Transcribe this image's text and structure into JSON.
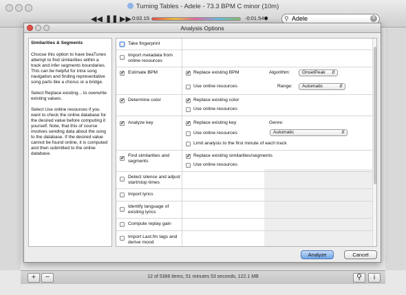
{
  "app": {
    "title": "Turning Tables - Adele - 73.3 BPM C minor (10m)",
    "elapsed": "0:02.15",
    "remaining": "-0:01.54",
    "search_value": "Adele",
    "status": "12 of 5386 items, 51 minutes 53 seconds, 122.1 MB"
  },
  "dialog": {
    "title": "Analysis Options",
    "help_heading": "Similarities & Segments",
    "help_paragraphs": [
      "Choose this option to have beaTunes attempt to find similarities within a track and infer segments boundaries. This can be helpful for intra song navigation and finding representative song parts like a chorus or a bridge.",
      "Select Replace existing... to overwrite existing values.",
      "Select Use online resources if you want to check the online database for the desired value before computing it yourself. Note, that this of course involves sending data about the song to the database. If the desired value cannot be found online, it is computed and then submitted to the online database."
    ],
    "options": [
      {
        "label": "Take fingerprint",
        "checked": false
      },
      {
        "label": "Import metadata from online resources",
        "checked": false
      },
      {
        "label": "Estimate BPM",
        "checked": true
      },
      {
        "label": "Determine color",
        "checked": true
      },
      {
        "label": "Analyze key",
        "checked": true
      },
      {
        "label": "Find similarities and segments",
        "checked": true
      },
      {
        "label": "Detect silence and adjust start/stop times",
        "checked": false
      },
      {
        "label": "Import lyrics",
        "checked": false
      },
      {
        "label": "Identify language of existing lyrics",
        "checked": false
      },
      {
        "label": "Compute replay gain",
        "checked": false
      },
      {
        "label": "Import Last.fm tags and derive mood",
        "checked": false
      }
    ],
    "bpm": {
      "replace_label": "Replace existing BPM",
      "replace_checked": true,
      "online_label": "Use online resources",
      "online_checked": false,
      "algorithm_label": "Algorithm:",
      "algorithm_value": "OnsetPeak",
      "range_label": "Range:",
      "range_value": "Automatic"
    },
    "color": {
      "replace_label": "Replace existing color",
      "replace_checked": true,
      "online_label": "Use online resources",
      "online_checked": false
    },
    "key": {
      "replace_label": "Replace existing key",
      "replace_checked": true,
      "online_label": "Use online resources",
      "online_checked": false,
      "genre_label": "Genre:",
      "genre_value": "Automatic",
      "limit_label": "Limit analysis to the first minute of each track",
      "limit_checked": false
    },
    "similarities": {
      "replace_label": "Replace existing similarities/segments",
      "replace_checked": true,
      "online_label": "Use online resources",
      "online_checked": false
    },
    "analyze_button": "Analyze",
    "cancel_button": "Cancel"
  }
}
